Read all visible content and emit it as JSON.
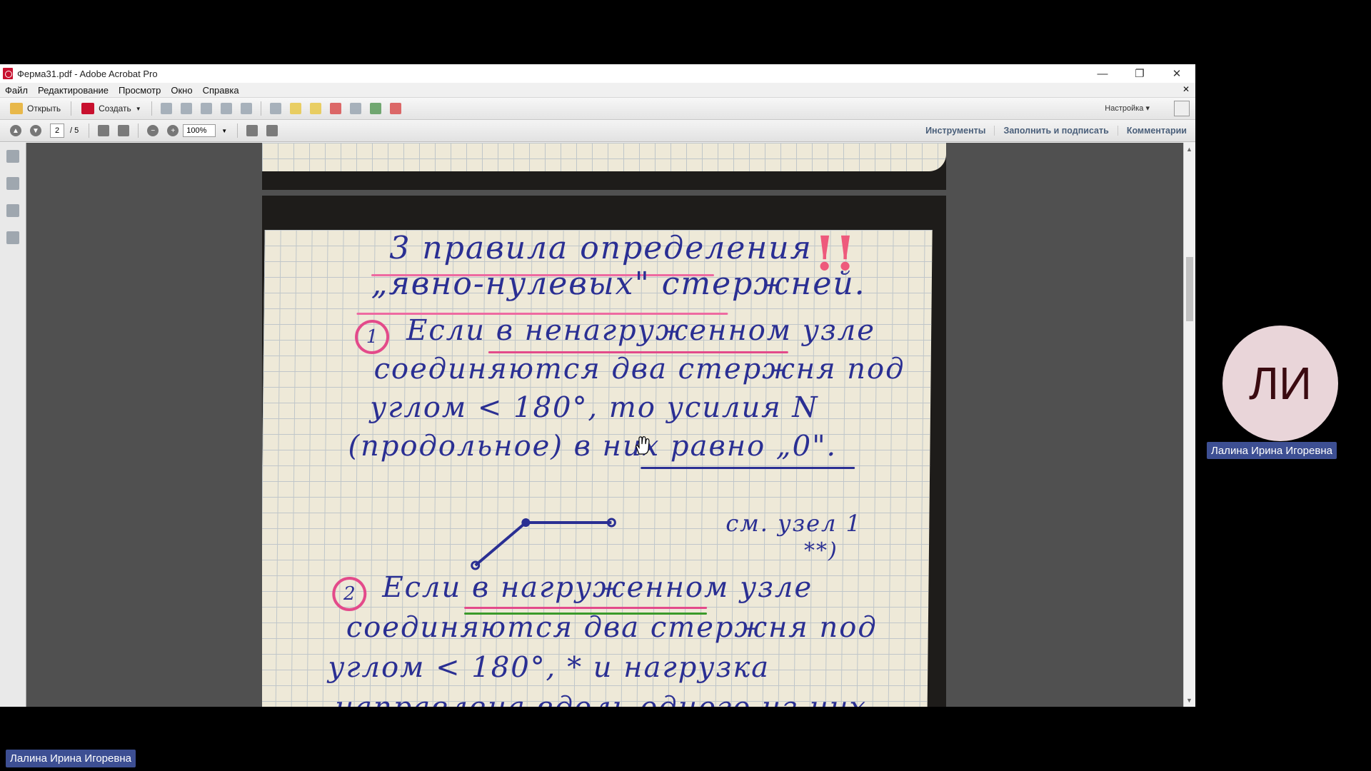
{
  "window": {
    "title": "Ферма31.pdf - Adobe Acrobat Pro"
  },
  "menu": [
    "Файл",
    "Редактирование",
    "Просмотр",
    "Окно",
    "Справка"
  ],
  "toolbar": {
    "open_label": "Открыть",
    "create_label": "Создать",
    "customize_label": "Настройка"
  },
  "nav": {
    "page_current": "2",
    "page_total": "/ 5",
    "zoom": "100%",
    "panels": [
      "Инструменты",
      "Заполнить и подписать",
      "Комментарии"
    ]
  },
  "note": {
    "title_line1": "3 правила определения",
    "title_line2": "„явно-нулевых\" стержней.",
    "rule1_num": "1",
    "rule1_line1": "Если в ненагруженном узле",
    "rule1_line2": "соединяются два стержня под",
    "rule1_line3": "углом < 180°, то усилия N",
    "rule1_line4": "(продольное) в них равно „0\".",
    "ref": "см. узел 1",
    "ref2": "**)",
    "rule2_num": "2",
    "rule2_line1": "Если в нагруженном узле",
    "rule2_line2": "соединяются два стержня под",
    "rule2_line3": "углом < 180°, * и нагрузка",
    "rule2_line4": "направлена вдоль одного из них"
  },
  "participant": {
    "initials": "ЛИ",
    "name": "Лалина Ирина Игоревна"
  },
  "self": {
    "name": "Лалина Ирина Игоревна"
  },
  "colors": {
    "accent": "#3d4f93",
    "ink": "#2a2f93",
    "highlight": "#e34a8a"
  }
}
